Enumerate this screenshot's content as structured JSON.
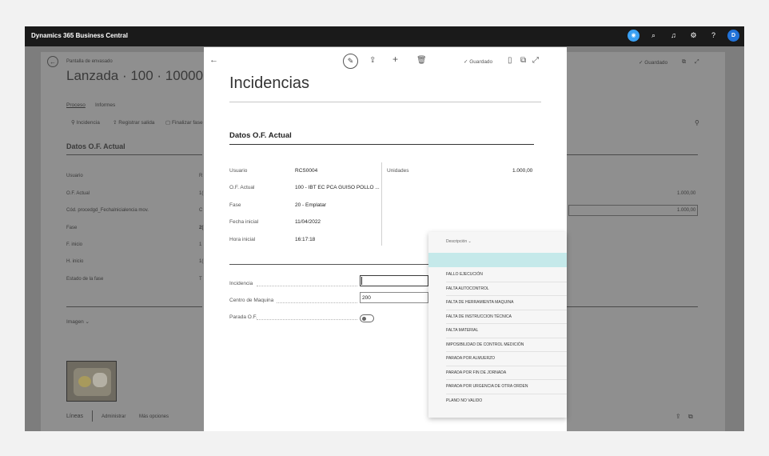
{
  "app": {
    "title": "Dynamics 365 Business Central",
    "avatar_letter": "D"
  },
  "topbar_icons": [
    "copilot-icon",
    "search-icon",
    "bell-icon",
    "gear-icon",
    "help-icon"
  ],
  "background_page": {
    "breadcrumb": "Pantalla de envasado",
    "title": "Lanzada · 100 · 10000 · CAT_P",
    "tabs": [
      "Proceso",
      "Informes"
    ],
    "actions": [
      "Incidencia",
      "Registrar salida",
      "Finalizar fase"
    ],
    "status": "✓ Guardado",
    "section_title": "Datos O.F. Actual",
    "fields": [
      {
        "label": "Usuario",
        "value": "R"
      },
      {
        "label": "O.F. Actual",
        "value": "1("
      },
      {
        "label": "Cód. procedgd_Fechalnicialencia mov.",
        "value": "C"
      },
      {
        "label": "Fase",
        "value": "2("
      },
      {
        "label": "F. inicio",
        "value": "1"
      },
      {
        "label": "H. inicio",
        "value": "1("
      },
      {
        "label": "Estado de la fase",
        "value": "T"
      }
    ],
    "right_values": [
      "1.000,00",
      "1.000,00"
    ],
    "image_label": "Imagen ⌄",
    "footer_tabs": [
      "Líneas",
      "Administrar",
      "Más opciones"
    ]
  },
  "dialog": {
    "title": "Incidencias",
    "status": "✓ Guardado",
    "section_title": "Datos O.F. Actual",
    "info_fields": [
      {
        "label": "Usuario",
        "value": "RCS0004"
      },
      {
        "label": "O.F. Actual",
        "value": "100 - IBT EC PCA GUISO POLLO ..."
      },
      {
        "label": "Fase",
        "value": "20 - Emplatar"
      },
      {
        "label": "Fecha inicial",
        "value": "11/04/2022"
      },
      {
        "label": "Hora inicial",
        "value": "16:17:18"
      }
    ],
    "units": {
      "label": "Unidades",
      "value": "1.000,00"
    },
    "form": {
      "incidencia_label": "Incidencia",
      "incidencia_value": "",
      "centro_label": "Centro de Maquina",
      "centro_value": "200",
      "parada_label": "Parada O.F.",
      "parada_value": false
    }
  },
  "dropdown": {
    "header": "Descripción ⌄",
    "options": [
      "",
      "FALLO EJECUCIÓN",
      "FALTA AUTOCONTROL",
      "FALTA DE HERRAMIENTA MAQUINA",
      "FALTA DE INSTRUCCION TÉCNICA",
      "FALTA MATERIAL",
      "IMPOSIBILIDAD DE CONTROL MEDICIÓN",
      "PARADA POR ALMUERZO",
      "PARADA POR FIN DE JORNADA",
      "PARADA POR URGENCIA DE OTRA ORDEN",
      "PLANO NO VALIDO"
    ]
  }
}
